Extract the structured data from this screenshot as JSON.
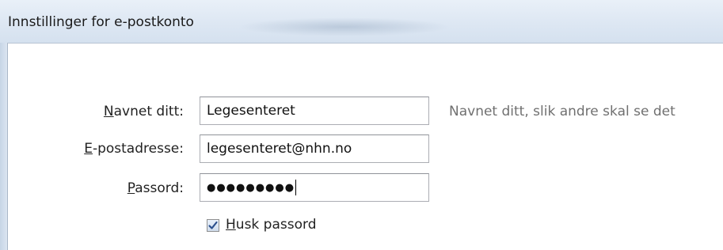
{
  "window": {
    "title": "Innstillinger for e-postkonto"
  },
  "form": {
    "name": {
      "label_access_key": "N",
      "label_rest": "avnet ditt:",
      "value": "Legesenteret",
      "hint": "Navnet ditt, slik andre skal se det"
    },
    "email": {
      "label_access_key": "E",
      "label_rest": "-postadresse:",
      "value": "legesenteret@nhn.no"
    },
    "password": {
      "label_access_key": "P",
      "label_rest": "assord:",
      "masked_value": "●●●●●●●●●"
    },
    "remember_password": {
      "label_access_key": "H",
      "label_rest": "usk passord",
      "checked": true
    }
  }
}
